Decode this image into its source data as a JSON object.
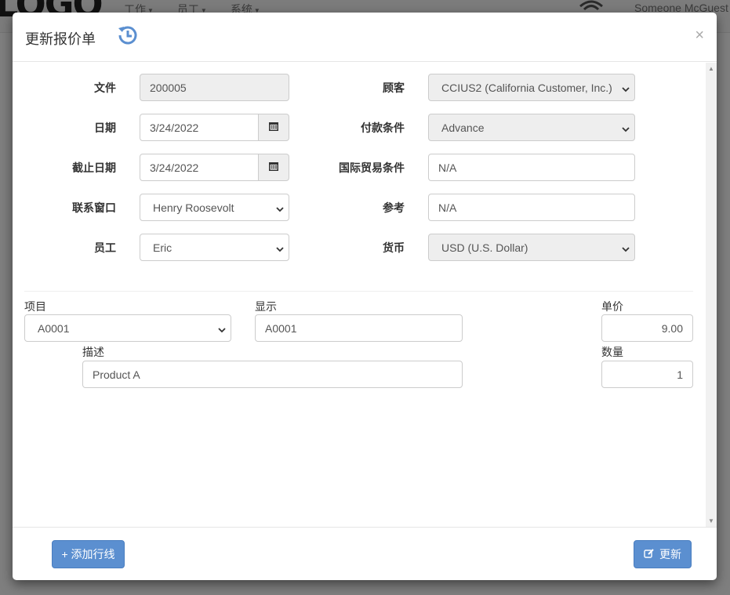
{
  "app": {
    "logo": "LOGO",
    "nav": [
      "工作",
      "员工",
      "系统"
    ],
    "user": "Someone McGuest"
  },
  "modal": {
    "title": "更新报价单",
    "close": "×"
  },
  "header_fields": {
    "doc": {
      "label": "文件",
      "value": "200005"
    },
    "date": {
      "label": "日期",
      "value": "3/24/2022"
    },
    "expire": {
      "label": "截止日期",
      "value": "3/24/2022"
    },
    "contact": {
      "label": "联系窗口",
      "value": "Henry Roosevolt"
    },
    "employee": {
      "label": "员工",
      "value": "Eric"
    },
    "customer": {
      "label": "顾客",
      "value": "CCIUS2 (California Customer, Inc.)"
    },
    "terms": {
      "label": "付款条件",
      "value": "Advance"
    },
    "incoterms": {
      "label": "国际贸易条件",
      "value": "N/A"
    },
    "reference": {
      "label": "参考",
      "value": "N/A"
    },
    "currency": {
      "label": "货币",
      "value": "USD (U.S. Dollar)"
    }
  },
  "line": {
    "item": {
      "label": "项目",
      "value": "A0001"
    },
    "display": {
      "label": "显示",
      "value": "A0001"
    },
    "unit_price": {
      "label": "单价",
      "value": "9.00"
    },
    "description": {
      "label": "描述",
      "value": "Product A"
    },
    "quantity": {
      "label": "数量",
      "value": "1"
    }
  },
  "footer": {
    "add_line": "+ 添加行线",
    "update": "更新"
  },
  "colors": {
    "primary": "#5b8fd0",
    "history_icon": "#5b8fd0"
  }
}
